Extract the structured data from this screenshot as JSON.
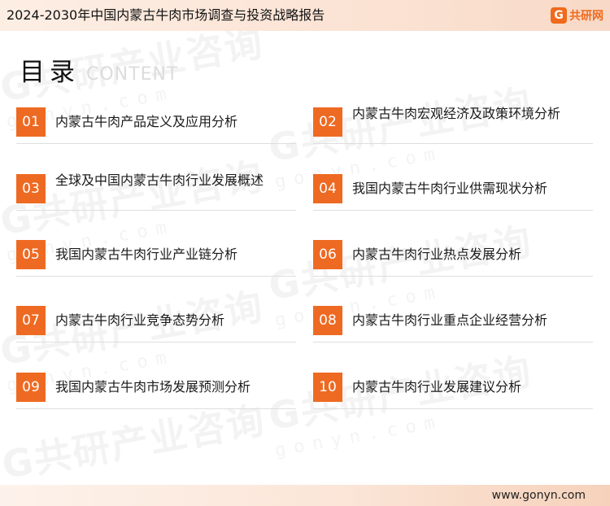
{
  "header": {
    "title": "2024-2030年中国内蒙古牛肉市场调查与投资战略报告",
    "brand_mark": "G",
    "brand_name": "共研网"
  },
  "watermark": {
    "text": "G共研产业咨询",
    "domain": "gonyn.com"
  },
  "section": {
    "title": "目录",
    "subtitle": "CONTENT"
  },
  "toc": [
    {
      "number": "01",
      "label": "内蒙古牛肉产品定义及应用分析"
    },
    {
      "number": "02",
      "label": "内蒙古牛肉宏观经济及政策环境分析"
    },
    {
      "number": "03",
      "label": "全球及中国内蒙古牛肉行业发展概述"
    },
    {
      "number": "04",
      "label": "我国内蒙古牛肉行业供需现状分析"
    },
    {
      "number": "05",
      "label": "我国内蒙古牛肉行业产业链分析"
    },
    {
      "number": "06",
      "label": "内蒙古牛肉行业热点发展分析"
    },
    {
      "number": "07",
      "label": "内蒙古牛肉行业竞争态势分析"
    },
    {
      "number": "08",
      "label": "内蒙古牛肉行业重点企业经营分析"
    },
    {
      "number": "09",
      "label": "我国内蒙古牛肉市场发展预测分析"
    },
    {
      "number": "10",
      "label": "内蒙古牛肉行业发展建议分析"
    }
  ],
  "footer": {
    "url": "www.gonyn.com"
  },
  "colors": {
    "accent": "#ee6a22",
    "brand": "#ef6a1c",
    "header_bg": "#fbe3d4"
  }
}
